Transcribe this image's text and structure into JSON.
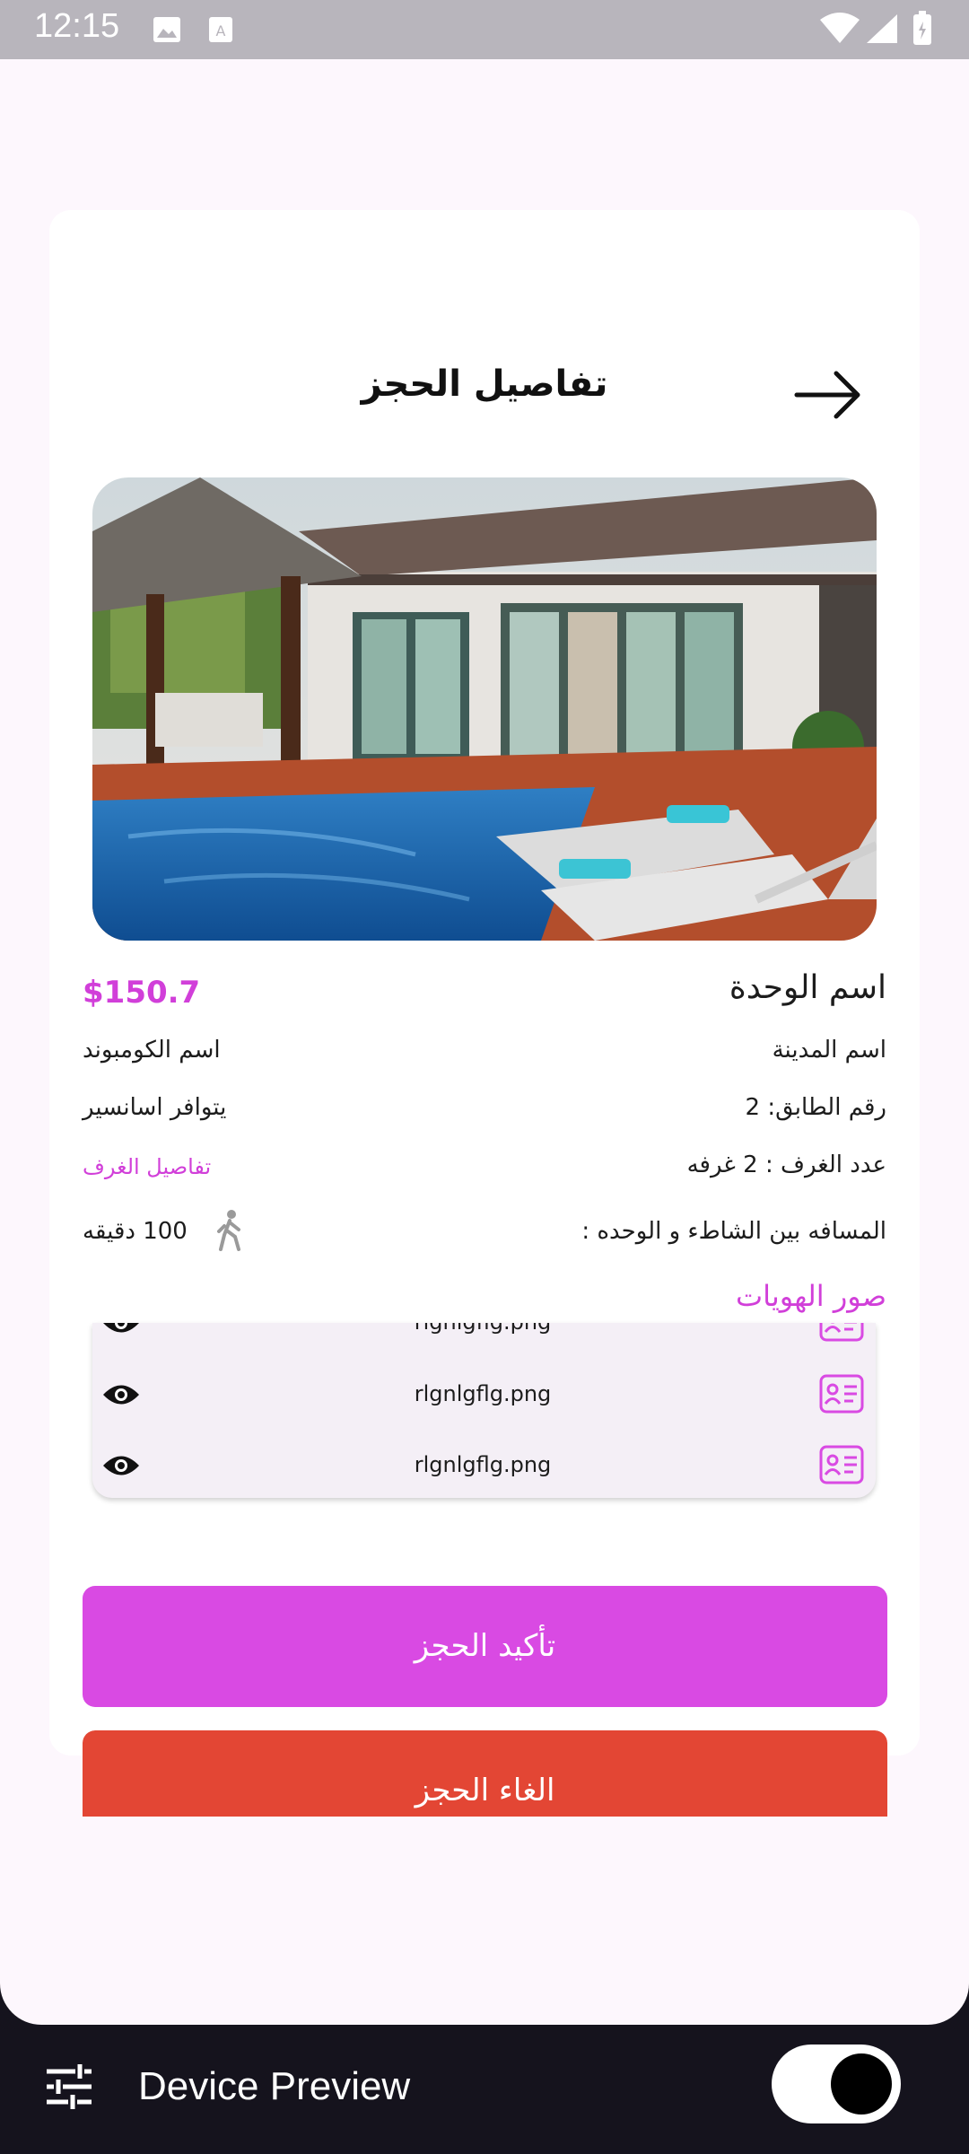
{
  "status_bar": {
    "time": "12:15"
  },
  "header": {
    "title": "تفاصيل الحجز",
    "back_icon": "arrow-right-icon"
  },
  "unit": {
    "name": "اسم الوحدة",
    "price": "$150.7",
    "city": "اسم المدينة",
    "compound": "اسم الكومبوند",
    "floor": "رقم الطابق: 2",
    "elevator": "يتوافر اسانسير",
    "rooms": "عدد الغرف : 2 غرفه",
    "rooms_details_link": "تفاصيل الغرف",
    "distance_label": "المسافه بين الشاطء و الوحده :",
    "distance_value": "100 دقيقه"
  },
  "ids": {
    "title": "صور الهويات",
    "files": [
      "rlgnlgflg.png",
      "rlgnlgflg.png",
      "rlgnlgflg.png"
    ]
  },
  "actions": {
    "confirm": "تأكيد الحجز",
    "cancel": "الغاء الحجز"
  },
  "colors": {
    "accent": "#d94ae3",
    "danger": "#e34634",
    "price": "#d13fd9"
  },
  "device_preview": {
    "label": "Device Preview",
    "toggle_on": true
  }
}
